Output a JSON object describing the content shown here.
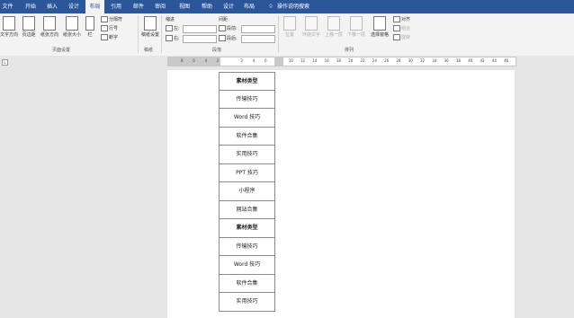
{
  "tabs": [
    "文件",
    "开始",
    "插入",
    "设计",
    "布局",
    "引用",
    "邮件",
    "审阅",
    "视图",
    "帮助",
    "设计",
    "布局"
  ],
  "active_tab": "布局",
  "tell_me": "操作说明搜索",
  "ribbon": {
    "page_setup": {
      "label": "页面设置",
      "buttons": [
        "文字方向",
        "页边距",
        "纸张方向",
        "纸张大小",
        "栏"
      ],
      "small": [
        "分隔符",
        "行号",
        "断字"
      ]
    },
    "manuscript": {
      "label": "稿纸",
      "button": "稿纸设置"
    },
    "paragraph": {
      "label": "段落",
      "indent": "缩进",
      "spacing": "间距",
      "left": "左:",
      "right": "右:",
      "before": "段前:",
      "after": "段后:"
    },
    "arrange": {
      "label": "排列",
      "buttons": [
        "位置",
        "环绕文字",
        "上移一层",
        "下移一层",
        "选择窗格"
      ],
      "small": [
        "对齐",
        "组合",
        "旋转"
      ]
    }
  },
  "ruler": {
    "ticks": [
      "8",
      "6",
      "4",
      "2",
      "",
      "2",
      "4",
      "6",
      "",
      "10",
      "12",
      "14",
      "16",
      "18",
      "20",
      "22",
      "24",
      "26",
      "28",
      "30",
      "32",
      "34",
      "36",
      "38",
      "40",
      "42",
      "44",
      "46"
    ]
  },
  "table": {
    "cells": [
      {
        "text": "素材类型",
        "bold": true
      },
      {
        "text": "传输技巧",
        "bold": false
      },
      {
        "text": "Word 技巧",
        "bold": false
      },
      {
        "text": "软件合集",
        "bold": false
      },
      {
        "text": "实用技巧",
        "bold": false
      },
      {
        "text": "PPT 技巧",
        "bold": false
      },
      {
        "text": "小程序",
        "bold": false
      },
      {
        "text": "网站合集",
        "bold": false
      },
      {
        "text": "素材类型",
        "bold": true
      },
      {
        "text": "传输技巧",
        "bold": false
      },
      {
        "text": "Word 技巧",
        "bold": false
      },
      {
        "text": "软件合集",
        "bold": false
      },
      {
        "text": "实用技巧",
        "bold": false
      }
    ]
  }
}
